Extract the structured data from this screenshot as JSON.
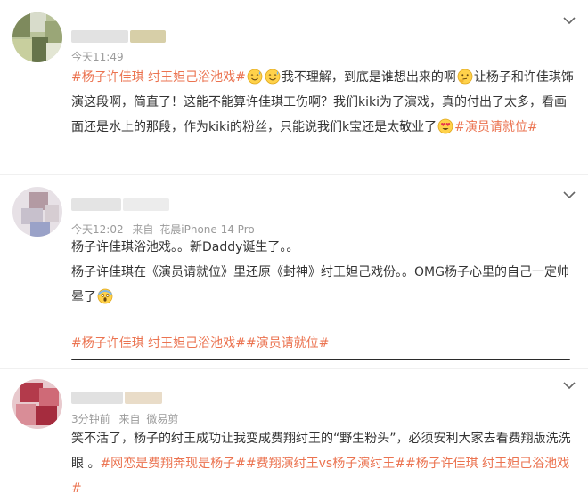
{
  "posts": [
    {
      "time": "今天11:49",
      "body": [
        {
          "t": "topic",
          "v": "#杨子许佳琪 纣王妲己浴池戏#"
        },
        {
          "t": "emoji",
          "v": "sweat-smile"
        },
        {
          "t": "emoji",
          "v": "sweat-smile"
        },
        {
          "t": "text",
          "v": "我不理解，到底是谁想出来的啊"
        },
        {
          "t": "emoji",
          "v": "thinking"
        },
        {
          "t": "text",
          "v": "让杨子和许佳琪饰演这段啊，简直了！这能不能算许佳琪工伤啊？我们kiki为了演戏，真的付出了太多，看画面还是水上的那段，作为kiki的粉丝，只能说我们k宝还是太敬业了"
        },
        {
          "t": "emoji",
          "v": "heart-eyes"
        },
        {
          "t": "topic",
          "v": "#演员请就位#"
        }
      ]
    },
    {
      "time": "今天12:02",
      "source_prefix": "来自",
      "source": "花晨iPhone 14 Pro",
      "lines": [
        [
          {
            "t": "text",
            "v": "杨子许佳琪浴池戏。。新Daddy诞生了。。"
          }
        ],
        [
          {
            "t": "text",
            "v": "杨子许佳琪在《演员请就位》里还原《封神》纣王妲己戏份。。OMG杨子心里的自己一定帅晕了"
          },
          {
            "t": "emoji",
            "v": "scream"
          }
        ],
        [],
        [
          {
            "t": "topic",
            "v": "#杨子许佳琪 纣王妲己浴池戏##演员请就位#"
          }
        ]
      ]
    },
    {
      "time": "3分钟前",
      "source_prefix": "来自",
      "source": "微易剪",
      "body": [
        {
          "t": "text",
          "v": "笑不活了，杨子的纣王成功让我变成费翔纣王的“野生粉头”，必须安利大家去看费翔版洗洗眼 。"
        },
        {
          "t": "topic",
          "v": "#网恋是费翔奔现是杨子##费翔演纣王vs杨子演纣王##杨子许佳琪 纣王妲己浴池戏#"
        }
      ]
    }
  ],
  "colors": {
    "topic": "#eb7350",
    "text": "#333333",
    "meta": "#9b9b9b",
    "divider": "#f0f0f0"
  },
  "icons": [
    "chevron-down-icon",
    "sweat-smile-emoji",
    "thinking-emoji",
    "heart-eyes-emoji",
    "scream-emoji"
  ]
}
